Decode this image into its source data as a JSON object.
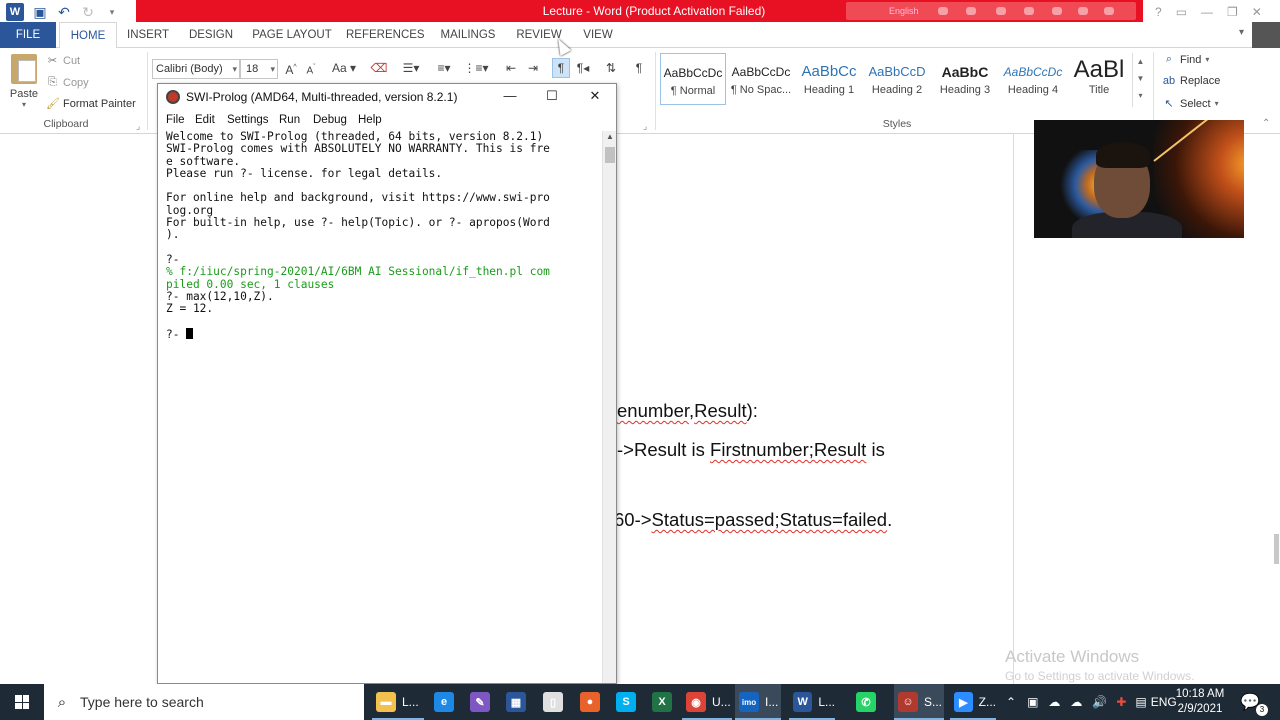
{
  "word": {
    "title": "Lecture - Word (Product Activation Failed)",
    "language_indicator": "English",
    "tabs": [
      "FILE",
      "HOME",
      "INSERT",
      "DESIGN",
      "PAGE LAYOUT",
      "REFERENCES",
      "MAILINGS",
      "REVIEW",
      "VIEW"
    ],
    "active_tab": "HOME",
    "clipboard": {
      "paste": "Paste",
      "cut": "Cut",
      "copy": "Copy",
      "format_painter": "Format Painter",
      "group_label": "Clipboard"
    },
    "font": {
      "name": "Calibri (Body)",
      "size": "18"
    },
    "styles": {
      "group_label": "Styles",
      "items": [
        {
          "sample": "AaBbCcDc",
          "name": "¶ Normal"
        },
        {
          "sample": "AaBbCcDc",
          "name": "¶ No Spac..."
        },
        {
          "sample": "AaBbCc",
          "name": "Heading 1"
        },
        {
          "sample": "AaBbCcD",
          "name": "Heading 2"
        },
        {
          "sample": "AaBbC",
          "name": "Heading 3"
        },
        {
          "sample": "AaBbCcDc",
          "name": "Heading 4"
        },
        {
          "sample": "AaBl",
          "name": "Title"
        }
      ]
    },
    "editing": {
      "find": "Find",
      "replace": "Replace",
      "select": "Select"
    },
    "document_lines": [
      {
        "text_plain": "",
        "parts": [
          {
            "t": "enumber",
            "sq": true
          },
          {
            "t": ",",
            "sq": false
          },
          {
            "t": "Result",
            "sq": true
          },
          {
            "t": "):",
            "sq": false
          }
        ]
      },
      {
        "parts": [
          {
            "t": "->Result is ",
            "sq": false
          },
          {
            "t": "Firstnumber;Result",
            "sq": true
          },
          {
            "t": " is",
            "sq": false
          }
        ]
      },
      {
        "parts": [
          {
            "t": "60->",
            "sq": false
          },
          {
            "t": "Status=passed;Status=failed",
            "sq": true
          },
          {
            "t": ".",
            "sq": false
          }
        ]
      }
    ],
    "watermark": {
      "line1": "Activate Windows",
      "line2": "Go to Settings to activate Windows."
    }
  },
  "prolog": {
    "title": "SWI-Prolog (AMD64, Multi-threaded, version 8.2.1)",
    "menu": [
      "File",
      "Edit",
      "Settings",
      "Run",
      "Debug",
      "Help"
    ],
    "console_lines": [
      {
        "text": "Welcome to SWI-Prolog (threaded, 64 bits, version 8.2.1)",
        "color": "normal"
      },
      {
        "text": "SWI-Prolog comes with ABSOLUTELY NO WARRANTY. This is fre",
        "color": "normal"
      },
      {
        "text": "e software.",
        "color": "normal"
      },
      {
        "text": "Please run ?- license. for legal details.",
        "color": "normal"
      },
      {
        "text": "",
        "color": "normal"
      },
      {
        "text": "For online help and background, visit https://www.swi-pro",
        "color": "normal"
      },
      {
        "text": "log.org",
        "color": "normal"
      },
      {
        "text": "For built-in help, use ?- help(Topic). or ?- apropos(Word",
        "color": "normal"
      },
      {
        "text": ").",
        "color": "normal"
      },
      {
        "text": "",
        "color": "normal"
      },
      {
        "text": "?-",
        "color": "normal"
      },
      {
        "text": "% f:/iiuc/spring-20201/AI/6BM AI Sessional/if_then.pl com",
        "color": "green"
      },
      {
        "text": "piled 0.00 sec, 1 clauses",
        "color": "green"
      },
      {
        "text": "?- max(12,10,Z).",
        "color": "normal"
      },
      {
        "text": "Z = 12.",
        "color": "normal"
      },
      {
        "text": "",
        "color": "normal"
      },
      {
        "text": "?- ",
        "color": "normal"
      }
    ]
  },
  "taskbar": {
    "search_placeholder": "Type here to search",
    "apps": [
      {
        "name": "file-explorer",
        "label": "L..."
      },
      {
        "name": "edge",
        "label": ""
      },
      {
        "name": "feather",
        "label": ""
      },
      {
        "name": "store",
        "label": ""
      },
      {
        "name": "notepad",
        "label": ""
      },
      {
        "name": "firefox",
        "label": ""
      },
      {
        "name": "skype",
        "label": ""
      },
      {
        "name": "excel",
        "label": ""
      },
      {
        "name": "chrome",
        "label": "U..."
      },
      {
        "name": "imo",
        "label": "I..."
      },
      {
        "name": "word",
        "label": "L..."
      },
      {
        "name": "whatsapp",
        "label": ""
      },
      {
        "name": "swi-prolog",
        "label": "S..."
      },
      {
        "name": "zoom",
        "label": "Z..."
      }
    ],
    "language": "ENG",
    "time": "10:18 AM",
    "date": "2/9/2021",
    "notification_count": "3"
  },
  "colors": {
    "word_blue": "#2b579a",
    "title_red": "#e81123",
    "taskbar": "#1e2a36",
    "prolog_green": "#1a9c1a"
  }
}
